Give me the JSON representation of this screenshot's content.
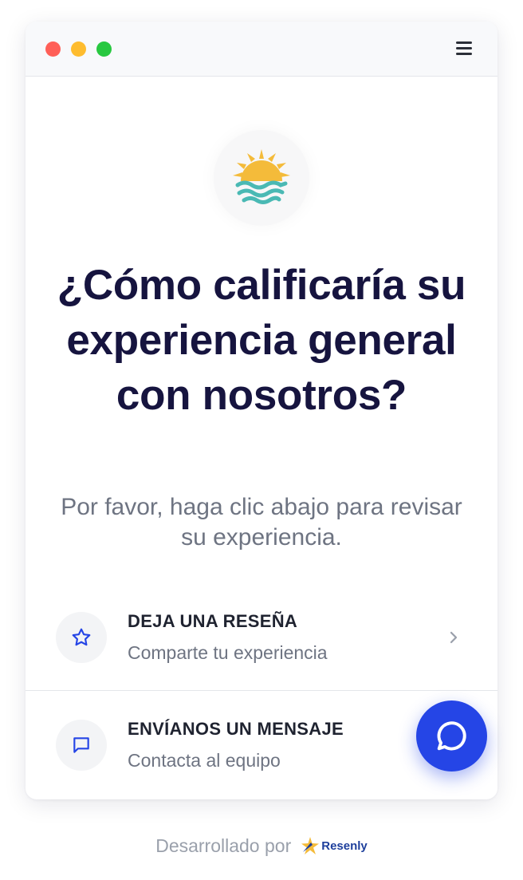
{
  "window": {
    "controls": [
      "close",
      "minimize",
      "maximize"
    ],
    "menu_icon": "hamburger-menu-icon"
  },
  "logo": {
    "icon": "sun-over-waves-logo"
  },
  "main": {
    "headline": "¿Cómo calificaría su experiencia general con nosotros?",
    "subtitle": "Por favor, haga clic abajo para revisar su experiencia."
  },
  "options": [
    {
      "icon": "star-icon",
      "title": "DEJA UNA RESEÑA",
      "subtitle": "Comparte tu experiencia",
      "arrow": "chevron-right-icon"
    },
    {
      "icon": "message-square-icon",
      "title": "ENVÍANOS UN MENSAJE",
      "subtitle": "Contacta al equipo"
    }
  ],
  "chat_button": {
    "icon": "chat-bubble-icon"
  },
  "footer": {
    "label": "Desarrollado por",
    "brand": "Resenly"
  },
  "colors": {
    "headline": "#16143f",
    "accent_blue": "#2545e6",
    "muted_text": "#6e7482",
    "sun": "#f4bb3a",
    "waves": "#4ab9b4"
  }
}
